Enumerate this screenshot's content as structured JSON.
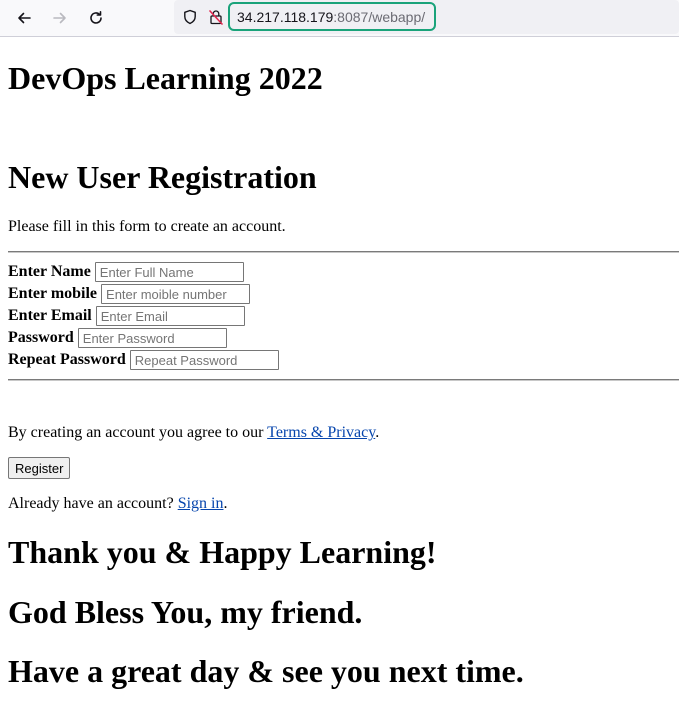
{
  "browser": {
    "url_host": "34.217.118.179",
    "url_rest": ":8087/webapp/"
  },
  "page": {
    "site_title": "DevOps Learning 2022",
    "form_title": "New User Registration",
    "form_intro": "Please fill in this form to create an account.",
    "fields": [
      {
        "label": "Enter Name",
        "placeholder": "Enter Full Name"
      },
      {
        "label": "Enter mobile",
        "placeholder": "Enter moible number"
      },
      {
        "label": "Enter Email",
        "placeholder": "Enter Email"
      },
      {
        "label": "Password",
        "placeholder": "Enter Password"
      },
      {
        "label": "Repeat Password",
        "placeholder": "Repeat Password"
      }
    ],
    "terms_prefix": "By creating an account you agree to our ",
    "terms_link": "Terms & Privacy",
    "terms_suffix": ".",
    "register_label": "Register",
    "signin_prefix": "Already have an account? ",
    "signin_link": "Sign in",
    "signin_suffix": ".",
    "closing_1": "Thank you & Happy Learning!",
    "closing_2": "God Bless You, my friend.",
    "closing_3": "Have a great day & see you next time."
  },
  "icons": [
    "back-arrow-icon",
    "forward-arrow-icon",
    "reload-icon",
    "shield-icon",
    "insecure-lock-icon"
  ]
}
